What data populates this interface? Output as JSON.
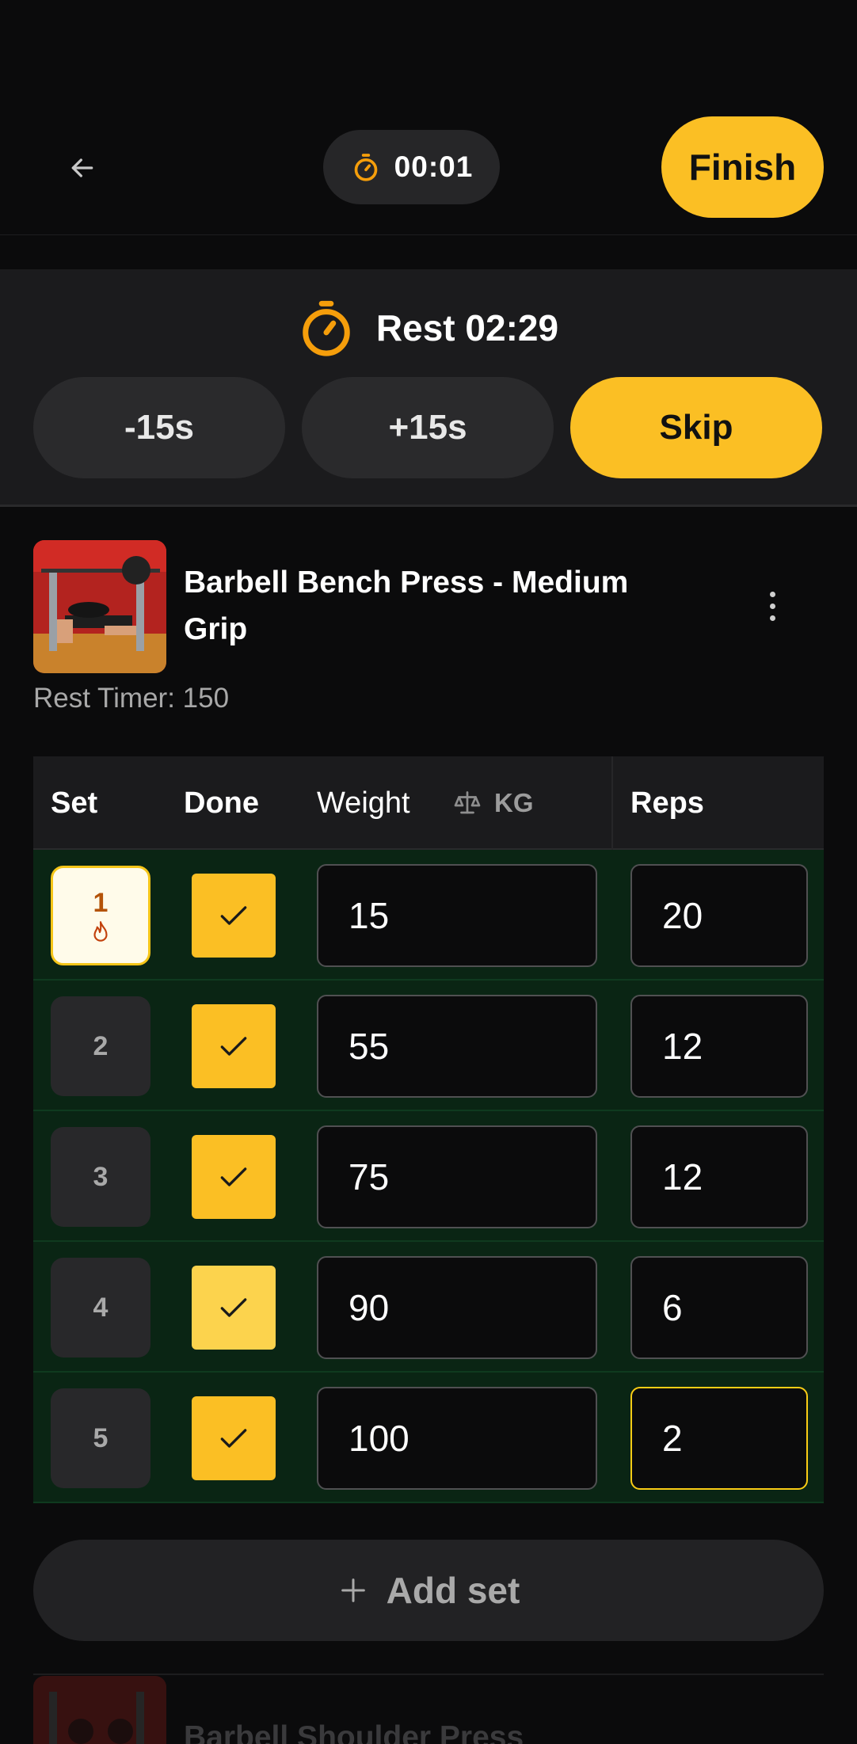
{
  "header": {
    "elapsed": "00:01",
    "finish_label": "Finish"
  },
  "rest": {
    "label": "Rest 02:29",
    "minus_label": "-15s",
    "plus_label": "+15s",
    "skip_label": "Skip"
  },
  "exercise": {
    "title": "Barbell Bench Press - Medium Grip",
    "rest_timer": "Rest Timer: 150"
  },
  "table": {
    "headers": {
      "set": "Set",
      "done": "Done",
      "weight": "Weight",
      "unit": "KG",
      "reps": "Reps"
    },
    "rows": [
      {
        "set": "1",
        "type": "warmup",
        "done": true,
        "weight": "15",
        "reps": "20"
      },
      {
        "set": "2",
        "type": "normal",
        "done": true,
        "weight": "55",
        "reps": "12"
      },
      {
        "set": "3",
        "type": "normal",
        "done": true,
        "weight": "75",
        "reps": "12"
      },
      {
        "set": "4",
        "type": "normal",
        "done": true,
        "weight": "90",
        "reps": "6"
      },
      {
        "set": "5",
        "type": "normal",
        "done": true,
        "weight": "100",
        "reps": "2"
      }
    ]
  },
  "add_set_label": "Add set",
  "next_exercise": {
    "title": "Barbell Shoulder Press"
  },
  "colors": {
    "accent": "#fbbf24",
    "completed_row": "#0a2514",
    "background": "#0b0b0c"
  }
}
